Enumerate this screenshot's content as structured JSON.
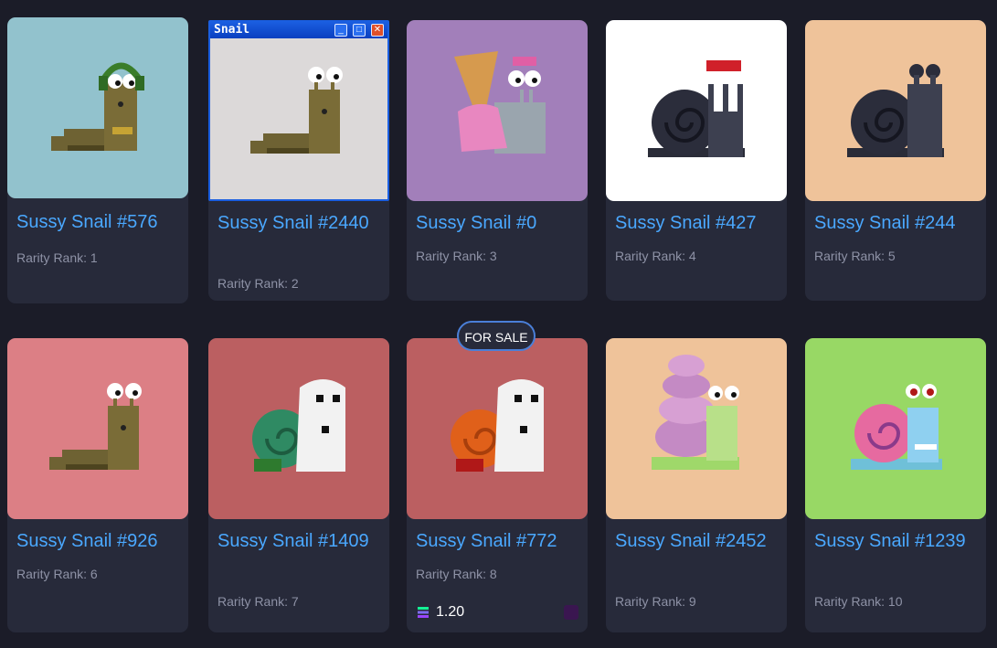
{
  "cards": [
    {
      "title": "Sussy Snail #576",
      "rank": "Rarity Rank: 1",
      "bg": "#92c2cd"
    },
    {
      "title": "Sussy Snail #2440",
      "rank": "Rarity Rank: 2",
      "bg": "#dcd9d9"
    },
    {
      "title": "Sussy Snail #0",
      "rank": "Rarity Rank: 3",
      "bg": "#a27fba"
    },
    {
      "title": "Sussy Snail #427",
      "rank": "Rarity Rank: 4",
      "bg": "#ffffff"
    },
    {
      "title": "Sussy Snail #244",
      "rank": "Rarity Rank: 5",
      "bg": "#efc39a"
    },
    {
      "title": "Sussy Snail #926",
      "rank": "Rarity Rank: 6",
      "bg": "#dc7f85"
    },
    {
      "title": "Sussy Snail #1409",
      "rank": "Rarity Rank: 7",
      "bg": "#bb5f61"
    },
    {
      "title": "Sussy Snail #772",
      "rank": "Rarity Rank: 8",
      "bg": "#bb5f61"
    },
    {
      "title": "Sussy Snail #2452",
      "rank": "Rarity Rank: 9",
      "bg": "#efc39a"
    },
    {
      "title": "Sussy Snail #1239",
      "rank": "Rarity Rank: 10",
      "bg": "#98d865"
    }
  ],
  "window_title": "Snail",
  "for_sale_badge": "FOR SALE",
  "listing": {
    "price": "1.20",
    "currency_icon": "solana-icon",
    "marketplace_icon": "magic-eden-icon"
  },
  "colors": {
    "background": "#1b1c28",
    "card": "#272a3a",
    "title": "#4aa8ff",
    "rank": "#8e92a6",
    "badge_border": "#4a7fd8"
  }
}
